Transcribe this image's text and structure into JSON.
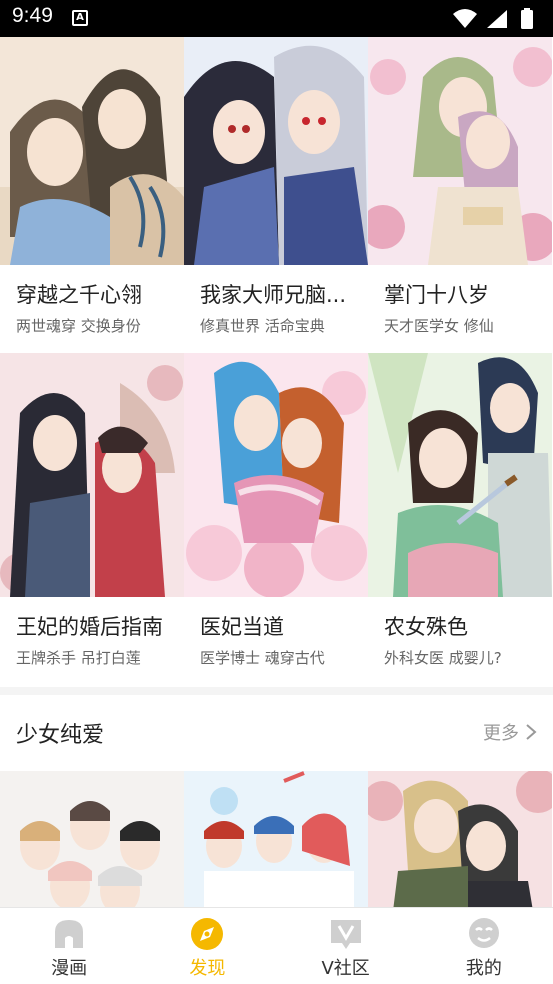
{
  "status_bar": {
    "time": "9:49",
    "notification_letter": "A"
  },
  "row1": [
    {
      "title": "穿越之千心翎",
      "tags": "两世魂穿 交换身份",
      "cover_palette": [
        "#f3e6d8",
        "#d9c2a6",
        "#8fb2d9",
        "#6b5b4a"
      ]
    },
    {
      "title": "我家大师兄脑...",
      "tags": "修真世界 活命宝典",
      "cover_palette": [
        "#e9eef7",
        "#2b2b3a",
        "#5a6fb0",
        "#c9ccd9"
      ]
    },
    {
      "title": "掌门十八岁",
      "tags": "天才医学女 修仙",
      "cover_palette": [
        "#f7e7ee",
        "#e9a8bd",
        "#a9b98a",
        "#efe2d0"
      ]
    }
  ],
  "row2": [
    {
      "title": "王妃的婚后指南",
      "tags": "王牌杀手 吊打白莲",
      "cover_palette": [
        "#f6e4e6",
        "#c2404a",
        "#2a2a35",
        "#e7b9be"
      ]
    },
    {
      "title": "医妃当道",
      "tags": "医学博士 魂穿古代",
      "cover_palette": [
        "#fbe6ee",
        "#4aa0d8",
        "#e596b6",
        "#f7c9d8"
      ]
    },
    {
      "title": "农女殊色",
      "tags": "外科女医 成婴儿?",
      "cover_palette": [
        "#eaf3e4",
        "#2c3a55",
        "#7fbf9a",
        "#e7a7b6"
      ]
    }
  ],
  "section": {
    "title": "少女纯爱",
    "more_label": "更多"
  },
  "row3": [
    {
      "cover_palette": [
        "#f4f2f0",
        "#5a4a44",
        "#f1c6c0",
        "#dcdcdc"
      ]
    },
    {
      "cover_palette": [
        "#eaf4fb",
        "#3a6fb8",
        "#e15b5b",
        "#bfe0f4"
      ]
    },
    {
      "cover_palette": [
        "#f6e1e3",
        "#3a3a3a",
        "#e9b3b9",
        "#d8c08a"
      ]
    }
  ],
  "nav": [
    {
      "label": "漫画",
      "icon": "home-icon",
      "active": false
    },
    {
      "label": "发现",
      "icon": "compass-icon",
      "active": true
    },
    {
      "label": "V社区",
      "icon": "v-community-icon",
      "active": false
    },
    {
      "label": "我的",
      "icon": "profile-icon",
      "active": false
    }
  ],
  "colors": {
    "accent": "#f5b800",
    "icon_inactive": "#cfcfcf",
    "text_primary": "#222222",
    "text_secondary": "#666666",
    "divider": "#f4f4f4"
  }
}
